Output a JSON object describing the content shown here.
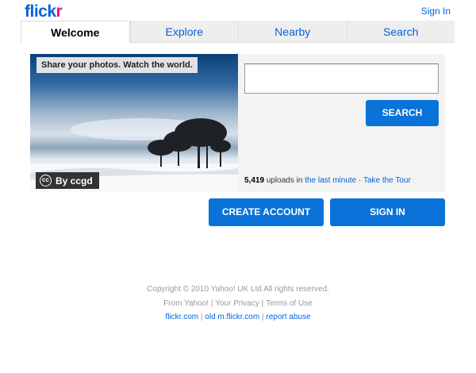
{
  "header": {
    "logo_blue": "flick",
    "logo_pink": "r",
    "signin_link": "Sign In"
  },
  "tabs": [
    {
      "label": "Welcome",
      "active": true
    },
    {
      "label": "Explore",
      "active": false
    },
    {
      "label": "Nearby",
      "active": false
    },
    {
      "label": "Search",
      "active": false
    }
  ],
  "hero": {
    "tagline": "Share your photos. Watch the world.",
    "cc_mark": "cc",
    "cc_credit": "By ccgd"
  },
  "search": {
    "input_value": "",
    "button_label": "SEARCH"
  },
  "uploads": {
    "count": "5,419",
    "text": "uploads in",
    "link_minute": "the last minute",
    "dot": "·",
    "link_tour": "Take the Tour"
  },
  "actions": {
    "create_account": "CREATE ACCOUNT",
    "sign_in": "SIGN IN"
  },
  "footer": {
    "copyright": "Copyright © 2010 Yahoo! UK Ltd All rights reserved.",
    "from_yahoo": "From Yahoo!",
    "privacy": "Your Privacy",
    "terms": "Terms of Use",
    "site": "flickr.com",
    "old_mobile": "old m.flickr.com",
    "report": "report abuse",
    "separator": "|"
  },
  "colors": {
    "brand_blue": "#0063dc",
    "brand_pink": "#ff0084",
    "button_blue": "#0a73d9"
  }
}
